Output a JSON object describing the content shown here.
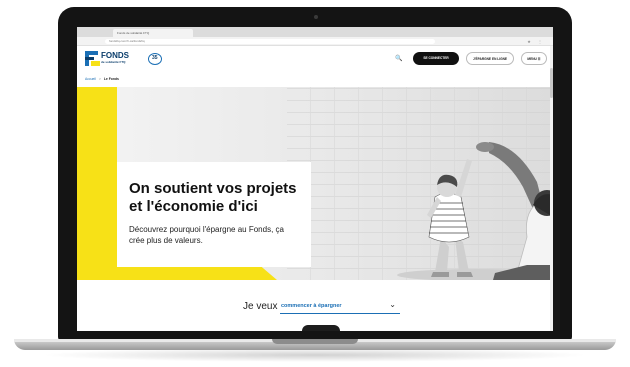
{
  "browser": {
    "tab_title": "Fonds de solidarité FTQ",
    "url": "fondsftq.com/fr-ca/fondsftq"
  },
  "header": {
    "logo_main": "FONDS",
    "logo_sub": "de solidarité FTQ",
    "logo_badge": "35",
    "login_label": "SE CONNECTER",
    "save_label": "J'ÉPARGNE EN LIGNE",
    "menu_label": "MENU ☰",
    "search_icon": "🔍"
  },
  "breadcrumb": {
    "home": "Accueil",
    "separator": ">",
    "current": "Le Fonds"
  },
  "hero": {
    "title": "On soutient vos projets et l'économie d'ici",
    "subtitle": "Découvrez pourquoi l'épargne au Fonds, ça crée plus de valeurs."
  },
  "je_veux": {
    "label": "Je veux",
    "selected": "commencer à épargner",
    "chevron": "⌄"
  },
  "colors": {
    "accent_yellow": "#f7e117",
    "brand_blue": "#1b6fb5",
    "dark": "#111111"
  }
}
